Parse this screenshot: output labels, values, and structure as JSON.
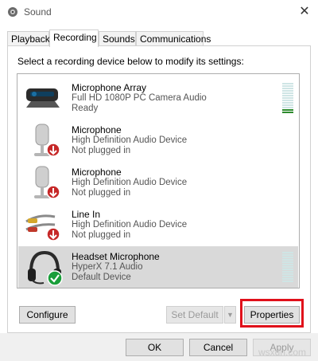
{
  "window": {
    "title": "Sound",
    "close_glyph": "✕"
  },
  "tabs": [
    {
      "label": "Playback"
    },
    {
      "label": "Recording"
    },
    {
      "label": "Sounds"
    },
    {
      "label": "Communications"
    }
  ],
  "instruction": "Select a recording device below to modify its settings:",
  "devices": [
    {
      "name": "Microphone Array",
      "desc": "Full HD 1080P PC Camera Audio",
      "status": "Ready",
      "icon": "camera-microphone-icon",
      "level": 0.15
    },
    {
      "name": "Microphone",
      "desc": "High Definition Audio Device",
      "status": "Not plugged in",
      "icon": "microphone-unplugged-icon"
    },
    {
      "name": "Microphone",
      "desc": "High Definition Audio Device",
      "status": "Not plugged in",
      "icon": "microphone-unplugged-icon"
    },
    {
      "name": "Line In",
      "desc": "High Definition Audio Device",
      "status": "Not plugged in",
      "icon": "line-in-unplugged-icon"
    },
    {
      "name": "Headset Microphone",
      "desc": "HyperX 7.1 Audio",
      "status": "Default Device",
      "icon": "headset-default-icon"
    }
  ],
  "buttons": {
    "configure": "Configure",
    "set_default": "Set Default",
    "properties": "Properties",
    "ok": "OK",
    "cancel": "Cancel",
    "apply": "Apply"
  },
  "colors": {
    "highlight": "#e0101a",
    "selected_row": "#d9d9d9",
    "meter_active": "#2e8b2e",
    "meter_idle": "#cfe5e5",
    "default_check": "#1a9e3a",
    "unplugged_badge": "#c62828"
  },
  "watermark": "wsxdn.com"
}
